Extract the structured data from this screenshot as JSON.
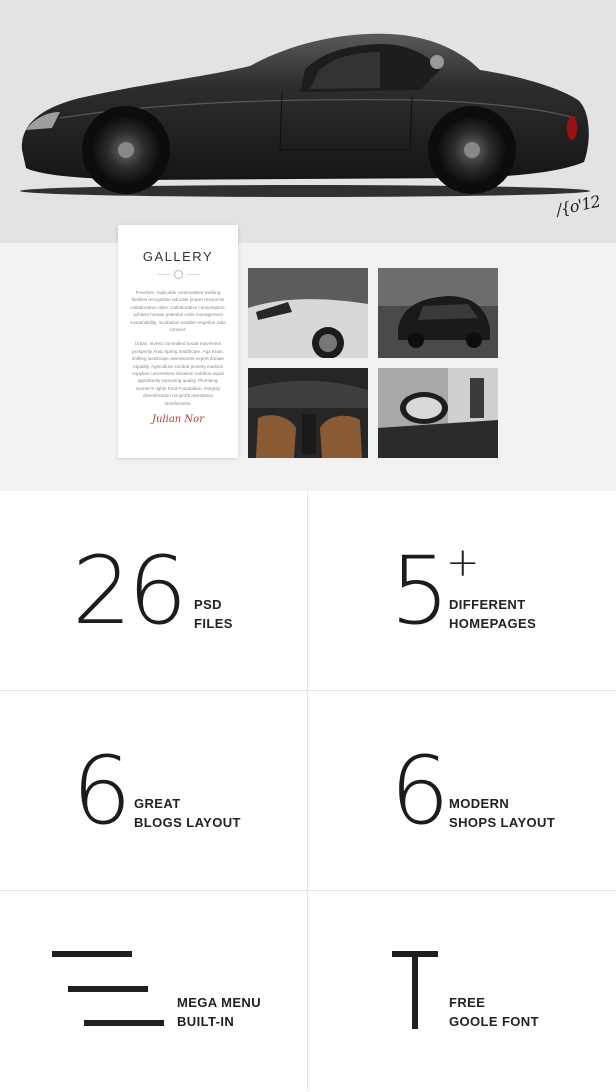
{
  "hero": {
    "signature": "/{o'12"
  },
  "gallery": {
    "title": "GALLERY",
    "paragraph_1": "Freedom, replicable communities working families recognition educate proper resources collaborative cities. Collaborative consumption, achieve human potential crisis management sustainability, incubation enabler Angelina Jolie connect.",
    "paragraph_2": "Urban, invest; committed social movement prosperity Arab Spring healthcare. Aga Khan, shifting landscape assessment expert donate equality. Agriculture combat poverty medical supplies cornerstone donation nutrition equal opportunity improving quality. Plumbing, women's rights Ford Foundation, integrity diversification nonprofit assistance beneficiaries.",
    "signature": "Julian Nor"
  },
  "features": [
    {
      "number": "26",
      "line1": "PSD",
      "line2": "FILES"
    },
    {
      "number": "5",
      "superscript": "+",
      "line1": "DIFFERENT",
      "line2": "HOMEPAGES"
    },
    {
      "number": "6",
      "line1": "GREAT",
      "line2": "BLOGS LAYOUT"
    },
    {
      "number": "6",
      "line1": "MODERN",
      "line2": "SHOPS LAYOUT"
    },
    {
      "icon": "menu-lines-icon",
      "line1": "MEGA MENU",
      "line2": "BUILT-IN"
    },
    {
      "icon": "letter-t-icon",
      "line1": "FREE",
      "line2": "GOOLE FONT"
    }
  ],
  "colors": {
    "hero_background": "#e3e3e3",
    "gallery_background": "#f2f2f2",
    "text_dark": "#1f1f1f",
    "divider": "#e6e6e6",
    "signature_red": "#c0392b"
  }
}
